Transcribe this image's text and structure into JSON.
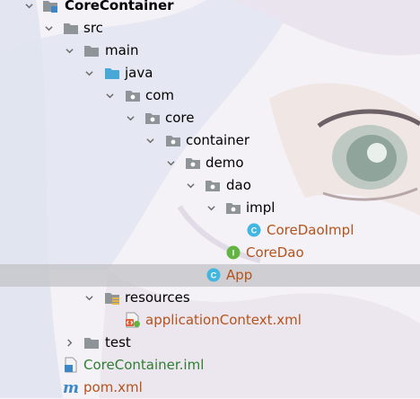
{
  "tree": {
    "items": [
      {
        "label": "CoreContainer"
      },
      {
        "label": "src"
      },
      {
        "label": "main"
      },
      {
        "label": "java"
      },
      {
        "label": "com"
      },
      {
        "label": "core"
      },
      {
        "label": "container"
      },
      {
        "label": "demo"
      },
      {
        "label": "dao"
      },
      {
        "label": "impl"
      },
      {
        "label": "CoreDaoImpl"
      },
      {
        "label": "CoreDao"
      },
      {
        "label": "App"
      },
      {
        "label": "resources"
      },
      {
        "label": "applicationContext.xml"
      },
      {
        "label": "test"
      },
      {
        "label": "CoreContainer.iml"
      },
      {
        "label": "pom.xml"
      }
    ],
    "selected_item": "App"
  },
  "badges": {
    "class_letter": "C",
    "interface_letter": "I",
    "maven_letter": "m"
  },
  "colors": {
    "class_name": "#b4531b",
    "iml_name": "#2e7d32",
    "folder_gray": "#8f9499",
    "source_folder_blue": "#4aa8d8",
    "class_badge": "#40b6e0",
    "interface_badge": "#62b543",
    "selection": "#c6c6ca"
  }
}
